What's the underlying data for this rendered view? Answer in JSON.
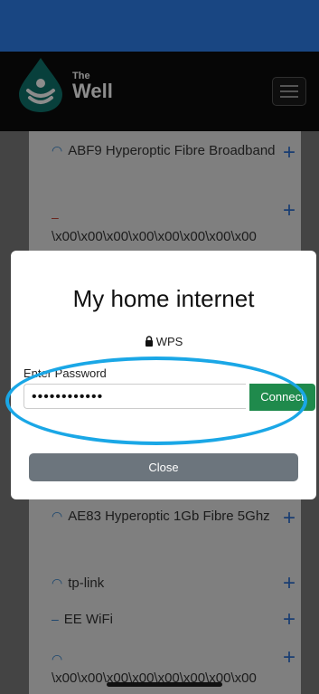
{
  "header": {
    "logo_small": "The",
    "logo_big": "Well"
  },
  "networks": [
    {
      "name": "ABF9 Hyperoptic Fibre Broadband"
    },
    {
      "name": "\\x00\\x00\\x00\\x00\\x00\\x00\\x00\\x00"
    },
    {
      "name": "AE83 Hyperoptic 1Gb Fibre 5Ghz"
    },
    {
      "name": "tp-link"
    },
    {
      "name": "EE WiFi"
    },
    {
      "name": "\\x00\\x00\\x00\\x00\\x00\\x00\\x00\\x00"
    }
  ],
  "modal": {
    "title": "My home internet",
    "security": "WPS",
    "password_label": "Enter Password",
    "password_value": "••••••••••••",
    "connect_label": "Connect",
    "close_label": "Close"
  },
  "icons": {
    "wifi": "wifi-icon",
    "lock": "lock-icon",
    "plus": "plus-icon",
    "menu": "hamburger-icon"
  },
  "colors": {
    "status_bar": "#2f80ed",
    "connect_button": "#1f8a4c",
    "close_button": "#6c757d",
    "annotation": "#1aa7e6"
  }
}
